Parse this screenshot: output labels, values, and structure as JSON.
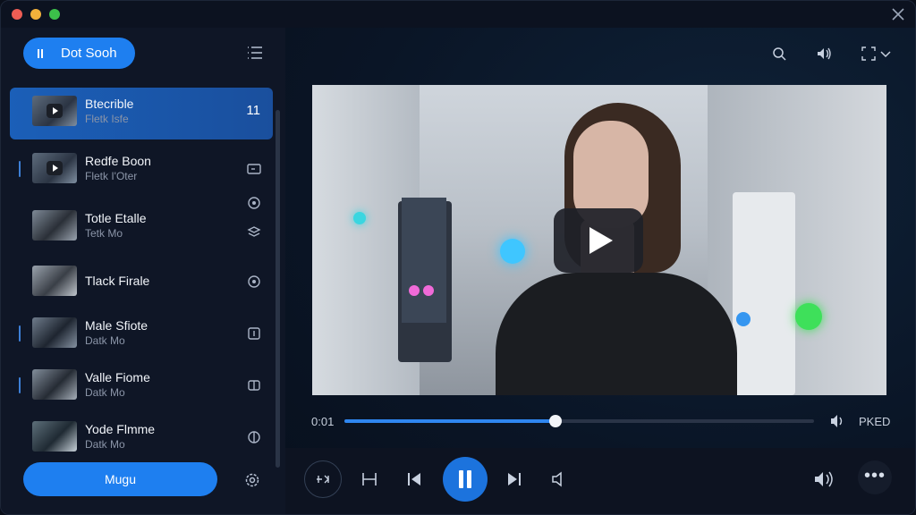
{
  "window": {
    "close_icon": "close-icon"
  },
  "sidebar": {
    "brand_label": "Dot Sooh",
    "menu_label": "Mugu",
    "items": [
      {
        "title": "Btecrible",
        "subtitle": "Fletk Isfe",
        "count": "11",
        "active": true,
        "icon": "play-thumb"
      },
      {
        "title": "Redfe Boon",
        "subtitle": "Fletk I'Oter",
        "icon": "screen-icon"
      },
      {
        "title": "Totle Etalle",
        "subtitle": "Tetk Mo",
        "icon": "gear-icon"
      },
      {
        "title": "Tlack Firale",
        "subtitle": "",
        "icon": "gear-icon"
      },
      {
        "title": "Male Sfiote",
        "subtitle": "Datk Mo",
        "icon": "info-icon"
      },
      {
        "title": "Valle Fiome",
        "subtitle": "Datk Mo",
        "icon": "split-icon"
      },
      {
        "title": "Yode Flmme",
        "subtitle": "Datk Mo",
        "icon": "split-icon"
      }
    ]
  },
  "player": {
    "current_time": "0:01",
    "speed_label": "PKED",
    "progress": 0.45
  },
  "colors": {
    "accent": "#1e7ff0",
    "active_item": "#1b5fb8",
    "background": "#0c1220"
  }
}
